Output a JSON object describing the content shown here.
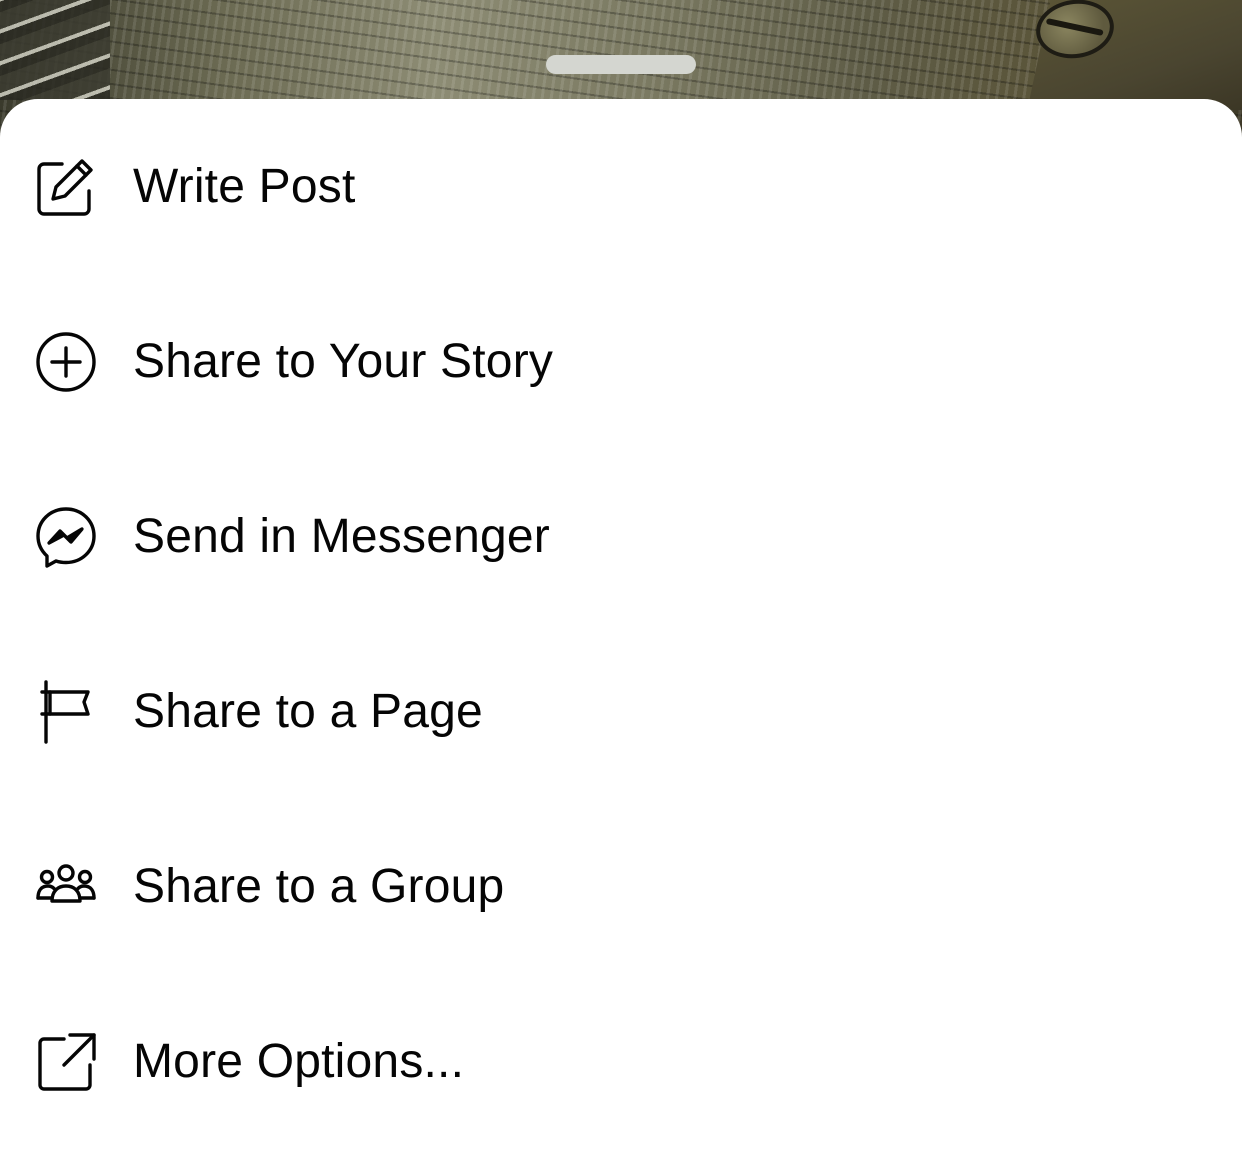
{
  "share_sheet": {
    "items": [
      {
        "id": "write-post",
        "label": "Write Post",
        "icon": "compose-icon"
      },
      {
        "id": "share-story",
        "label": "Share to Your Story",
        "icon": "plus-circle-icon"
      },
      {
        "id": "send-messenger",
        "label": "Send in Messenger",
        "icon": "messenger-icon"
      },
      {
        "id": "share-page",
        "label": "Share to a Page",
        "icon": "flag-icon"
      },
      {
        "id": "share-group",
        "label": "Share to a Group",
        "icon": "group-icon"
      },
      {
        "id": "more-options",
        "label": "More Options...",
        "icon": "external-share-icon"
      }
    ]
  },
  "colors": {
    "text": "#050505",
    "icon": "#050505",
    "sheet_background": "#ffffff",
    "grabber": "#d4d6d0"
  }
}
